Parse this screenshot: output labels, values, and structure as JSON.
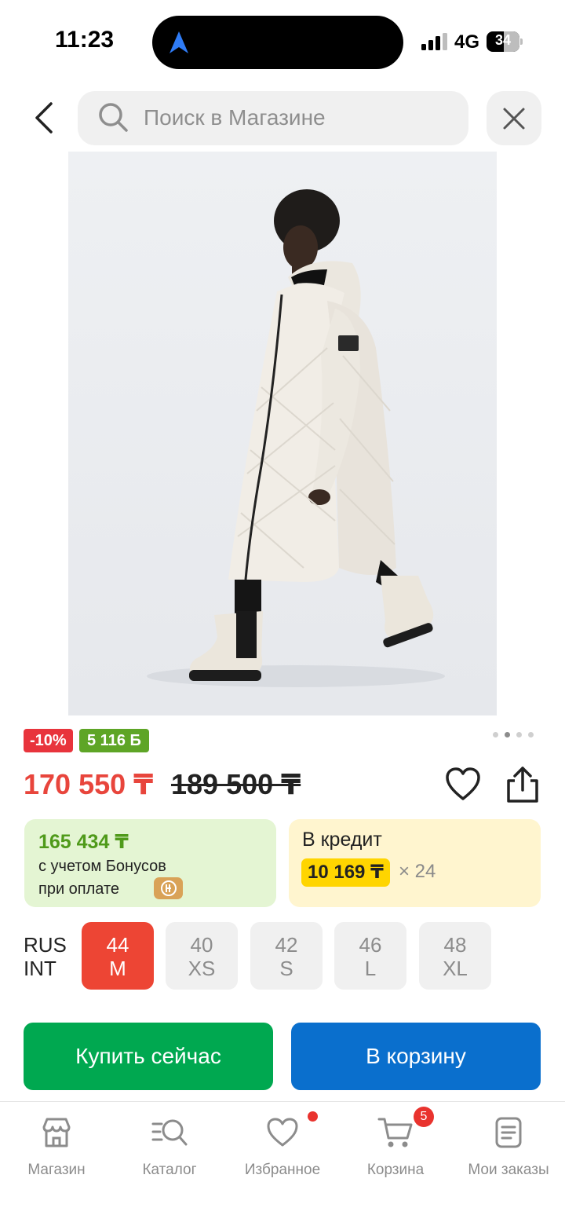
{
  "status_bar": {
    "time": "11:23",
    "network": "4G",
    "battery": "34"
  },
  "header": {
    "search_placeholder": "Поиск в Магазине"
  },
  "product": {
    "image_dots_active": 2,
    "image_dots_total": 4,
    "discount_badge": "-10%",
    "bonus_badge": "5 116 Б",
    "price": "170 550 ₸",
    "old_price": "189 500 ₸",
    "bonus_card": {
      "amount": "165 434 ₸",
      "line1": "с учетом Бонусов",
      "line2": "при оплате"
    },
    "credit_card": {
      "title": "В кредит",
      "monthly": "10 169 ₸",
      "months": "× 24"
    },
    "size_system": {
      "line1": "RUS",
      "line2": "INT"
    },
    "sizes": [
      {
        "rus": "44",
        "int": "M",
        "selected": true
      },
      {
        "rus": "40",
        "int": "XS",
        "selected": false
      },
      {
        "rus": "42",
        "int": "S",
        "selected": false
      },
      {
        "rus": "46",
        "int": "L",
        "selected": false
      },
      {
        "rus": "48",
        "int": "XL",
        "selected": false
      }
    ]
  },
  "actions": {
    "buy_now": "Купить сейчас",
    "add_to_cart": "В корзину"
  },
  "tabbar": {
    "items": [
      {
        "label": "Магазин",
        "icon": "store-icon"
      },
      {
        "label": "Каталог",
        "icon": "catalog-search-icon"
      },
      {
        "label": "Избранное",
        "icon": "heart-icon"
      },
      {
        "label": "Корзина",
        "icon": "cart-icon",
        "badge": "5"
      },
      {
        "label": "Мои заказы",
        "icon": "orders-icon"
      }
    ]
  },
  "colors": {
    "price_red": "#e8453c",
    "bonus_green": "#5ea526",
    "buy_green": "#00a850",
    "cart_blue": "#0a6fcd",
    "selected_size": "#ed4534",
    "credit_yellow": "#ffd500"
  }
}
